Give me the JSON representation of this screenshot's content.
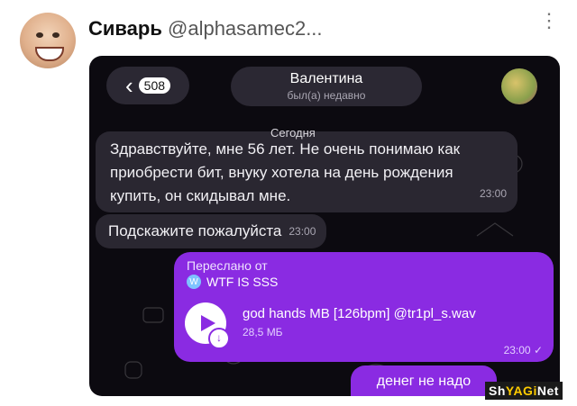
{
  "tweet": {
    "author_name": "Сиварь",
    "author_handle": "@alphasamec2...",
    "more_icon": "⋮"
  },
  "chat_header": {
    "back_icon": "‹",
    "unread_badge": "508",
    "contact_name": "Валентина",
    "contact_status": "был(а) недавно"
  },
  "chat": {
    "date_label": "Сегодня",
    "messages": [
      {
        "text": "Здравствуйте, мне 56 лет. Не очень понимаю как приобрести бит, внуку хотела на день рождения купить, он скидывал мне.",
        "time": "23:00"
      },
      {
        "text": "Подскажите пожалуйста",
        "time": "23:00"
      }
    ],
    "forwarded": {
      "forwarded_from_label": "Переслано от",
      "channel_name": "WTF IS SSS",
      "channel_icon": "W",
      "file_name": "god hands MB [126bpm] @tr1pl_s.wav",
      "file_size": "28,5 МБ",
      "time": "23:00",
      "status_icon": "✓",
      "download_icon": "↓"
    },
    "last_message": "денег не надо"
  },
  "watermark": {
    "part1": "Sh",
    "part2": "YAGi",
    "part3": "Net"
  }
}
